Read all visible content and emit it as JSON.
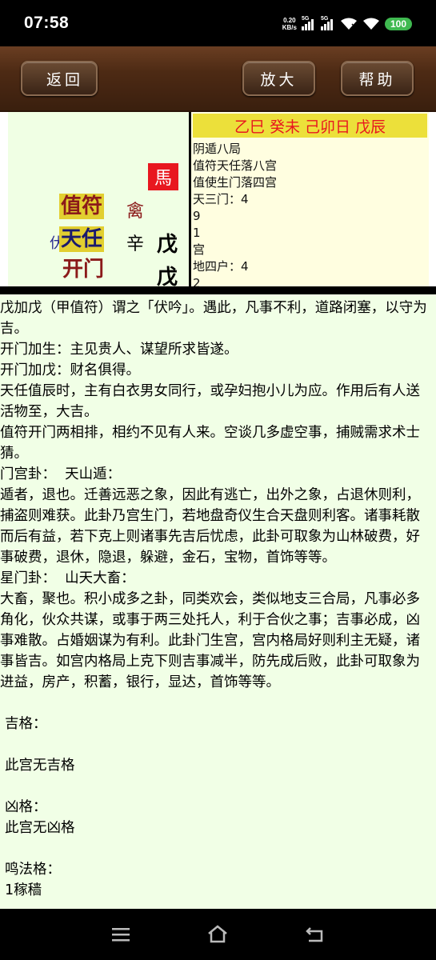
{
  "status": {
    "time": "07:58",
    "net_speed_value": "0.20",
    "net_speed_unit": "KB/s",
    "signal1_label": "5G",
    "signal2_label": "5G",
    "battery": "100"
  },
  "toolbar": {
    "back_label": "返回",
    "zoom_label": "放大",
    "help_label": "帮助"
  },
  "palace": {
    "horse": "馬",
    "deity": "值符",
    "star": "天任",
    "door": "开门",
    "qin": "禽",
    "xin": "辛",
    "fu": "伏",
    "stem_heaven": "戊",
    "stem_earth": "戊"
  },
  "info": {
    "ganzhi": "乙巳 癸未 己卯日 戊辰",
    "lines": [
      "阴遁八局",
      "值符天任落八宫",
      "值使生门落四宫",
      "天三门：4",
      "9",
      "1",
      "宫",
      "地四户：4",
      "2"
    ]
  },
  "content": {
    "paragraphs": [
      "戊加戊（甲值符）谓之「伏吟」。遇此，凡事不利，道路闭塞，以守为吉。",
      "开门加生：主见贵人、谋望所求皆遂。",
      "开门加戊：财名俱得。",
      "天任值辰时，主有白衣男女同行，或孕妇抱小儿为应。作用后有人送活物至，大吉。",
      "值符开门两相排，相约不见有人来。空谈几多虚空事，捕贼需求术士猜。",
      "门宫卦：  天山遁：",
      "遁者，退也。迁善远恶之象，因此有逃亡，出外之象，占退休则利，捕盗则难获。此卦乃宫生门，若地盘奇仪生合天盘则利客。诸事耗散而后有益，若下克上则诸事先吉后忧虑，此卦可取象为山林破费，好事破费，退休，隐退，躲避，金石，宝物，首饰等等。",
      "星门卦：  山天大畜：",
      "大畜，聚也。积小成多之卦，同类欢会，类似地支三合局，凡事必多角化，伙众共谋，或事于两三处托人，利于合伙之事；吉事必成，凶事难散。占婚姻谋为有利。此卦门生宫，宫内格局好则利主无疑，诸事皆吉。如宫内格局上克下则吉事减半，防先成后败，此卦可取象为进益，房产，积蓄，银行，显达，首饰等等。"
    ],
    "ji_label": "吉格：",
    "ji_value": "此宫无吉格",
    "xiong_label": "凶格：",
    "xiong_value": "此宫无凶格",
    "ming_label": "鸣法格：",
    "ming_value": "1稼穑"
  }
}
